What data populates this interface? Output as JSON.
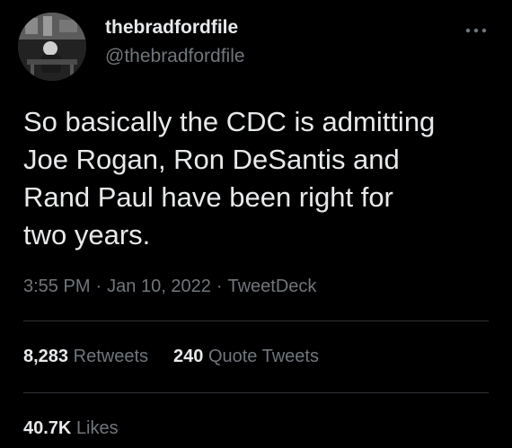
{
  "author": {
    "display_name": "thebradfordfile",
    "handle": "@thebradfordfile"
  },
  "menu_icon": "more-dots-icon",
  "tweet": {
    "text": "So basically the CDC is admitting\nJoe Rogan, Ron DeSantis and\nRand Paul have been right for\ntwo years.",
    "time": "3:55 PM",
    "separator": "·",
    "date": "Jan 10, 2022",
    "source": "TweetDeck"
  },
  "stats": {
    "retweets_count": "8,283",
    "retweets_label": "Retweets",
    "quotes_count": "240",
    "quotes_label": "Quote Tweets",
    "likes_count": "40.7K",
    "likes_label": "Likes"
  },
  "colors": {
    "background": "#000000",
    "primary_text": "#e7e9ea",
    "secondary_text": "#71767b",
    "divider": "#2f3336"
  }
}
